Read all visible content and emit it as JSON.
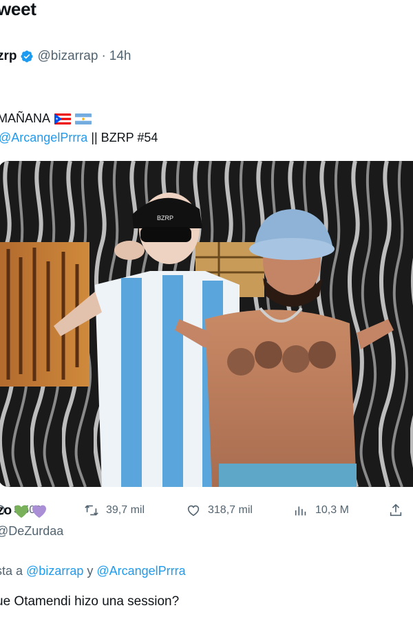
{
  "header": {
    "title": "weet"
  },
  "tweet": {
    "author_name": "zrp",
    "author_handle": "@bizarrap",
    "separator": "·",
    "time": "14h",
    "text_line1": "MAÑANA",
    "flags": [
      "puerto-rico-flag",
      "argentina-flag"
    ],
    "mention": "@ArcangelPrrra",
    "text_line2_rest": " || BZRP #54",
    "media": {
      "description_icon": "photo-image",
      "cap_text": "BZRP"
    },
    "colors": {
      "accent": "#1d9bf0",
      "muted": "#536471",
      "text": "#0f1419"
    }
  },
  "actions": {
    "replies": "3.500",
    "retweets": "39,7 mil",
    "likes": "318,7 mil",
    "views": "10,3 M"
  },
  "reply": {
    "author_name": "zo",
    "hearts": [
      "green-heart",
      "purple-heart"
    ],
    "author_handle": "@DeZurdaa",
    "replying_prefix": "sta a ",
    "replying_mention1": "@bizarrap",
    "replying_joiner": " y ",
    "replying_mention2": "@ArcangelPrrra",
    "text": "ue Otamendi hizo una session?"
  }
}
